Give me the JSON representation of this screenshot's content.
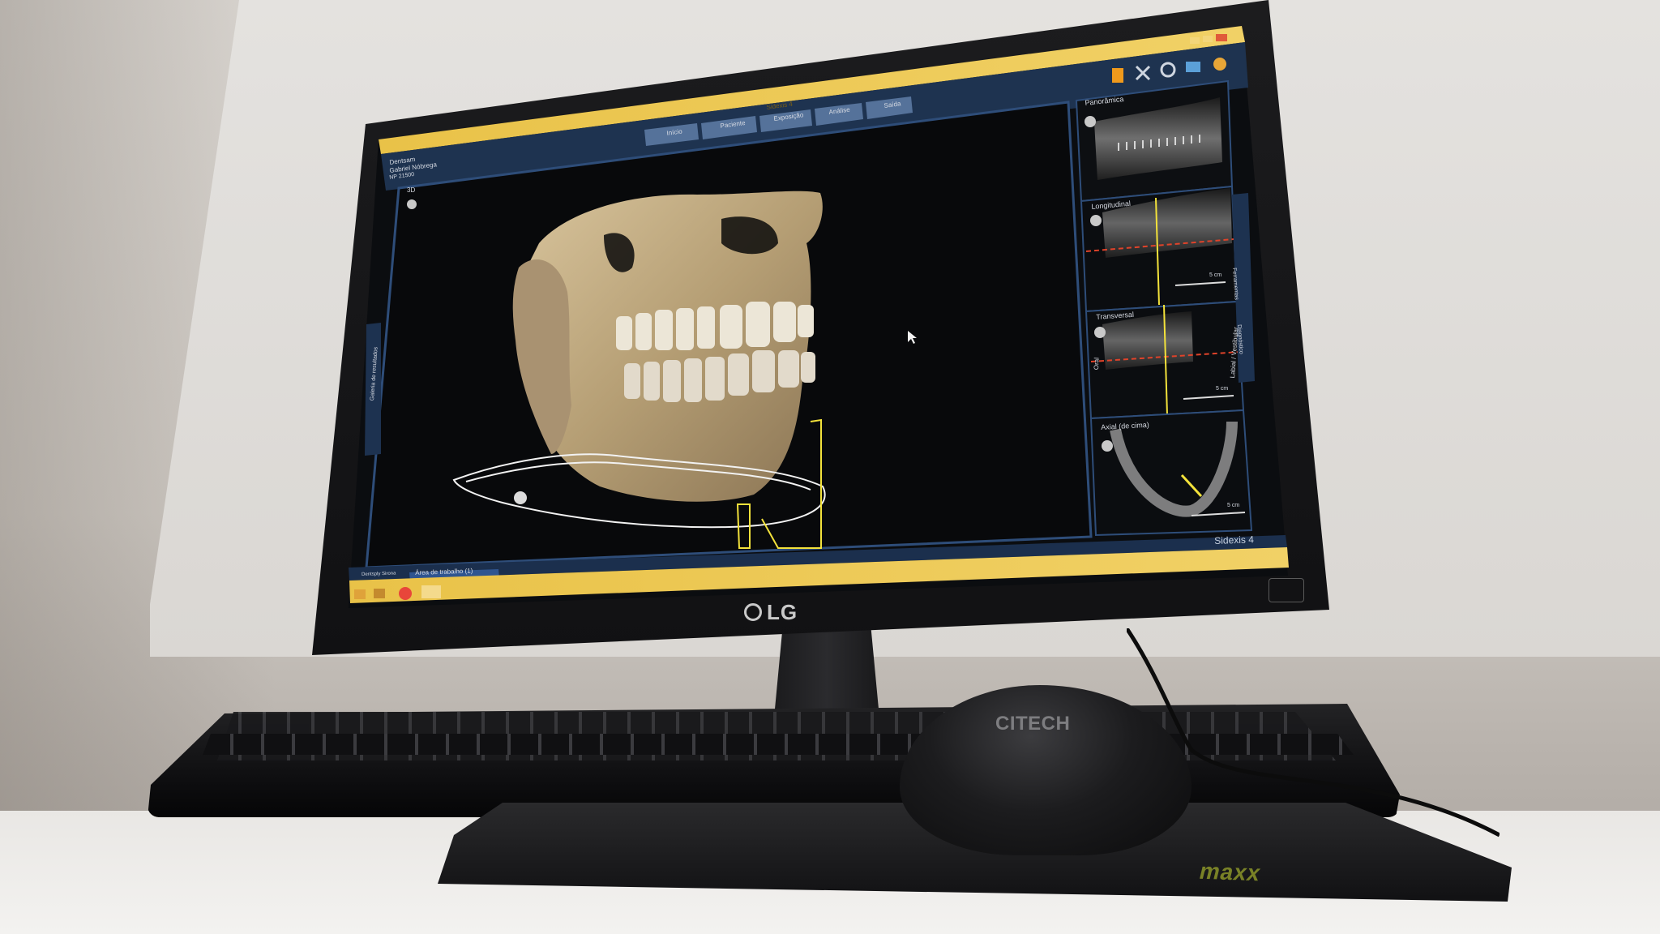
{
  "window": {
    "title": "Sidexis 4",
    "app_label": "Sidexis 4",
    "patient": {
      "line1": "Dentsam",
      "line2": "Gabriel Nóbrega",
      "line3": "NP 21500"
    }
  },
  "nav_tabs": [
    {
      "label": "Início"
    },
    {
      "label": "Paciente"
    },
    {
      "label": "Exposição"
    },
    {
      "label": "Análise"
    },
    {
      "label": "Saída"
    }
  ],
  "viewport_3d": {
    "label": "3D"
  },
  "right_panels": [
    {
      "label": "Panorâmica"
    },
    {
      "label": "Longitudinal"
    },
    {
      "label": "Transversal",
      "side_labels": [
        "Oral",
        "Labial / Vestibular"
      ]
    },
    {
      "label": "Axial (de cima)"
    }
  ],
  "scale_label": "5 cm",
  "side_tabs": {
    "left": "Galeria de resultados",
    "right": [
      "Ferramentas",
      "Diagnóstico"
    ]
  },
  "bottom_bar": {
    "workspace_tab": "Área de trabalho (1)",
    "left_label": "Dentsply Sirona"
  },
  "hardware": {
    "monitor_brand": "LG",
    "mouse_brand": "CITECH",
    "mousepad_brand": "maxx"
  },
  "colors": {
    "screen_bg": "#090b0d",
    "taskbar_accent": "#e8b93a",
    "ui_blue": "#2a4a7a",
    "bone": "#c9b58e",
    "guide_yellow": "#f3e23b",
    "guide_red": "#e0432a"
  }
}
